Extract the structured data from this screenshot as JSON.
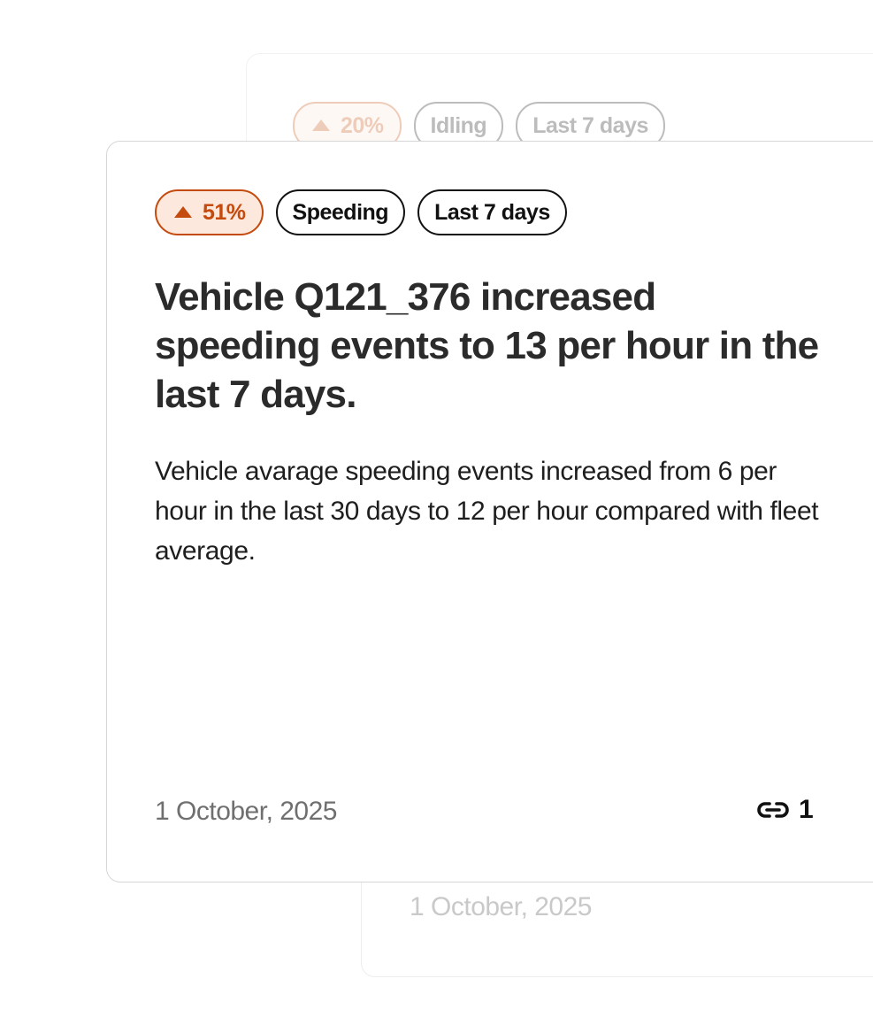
{
  "main_card": {
    "trend_value": "51%",
    "category": "Speeding",
    "period": "Last 7 days",
    "title": "Vehicle Q121_376 increased speeding events to 13 per hour in the last 7 days.",
    "description": "Vehicle avarage speeding events increased from 6 per hour in the last 30 days to 12 per hour compared with fleet average.",
    "date": "1 October, 2025",
    "link_count": "1",
    "link_icon": "link-icon"
  },
  "background_card_top": {
    "trend_value": "20%",
    "category": "Idling",
    "period": "Last 7 days"
  },
  "background_card_bottom": {
    "date": "1 October, 2025"
  },
  "colors": {
    "trend_accent": "#c54a0d",
    "trend_background": "#fde8dd",
    "text_primary": "#2b2b2b",
    "text_muted": "#6f6f6f"
  }
}
